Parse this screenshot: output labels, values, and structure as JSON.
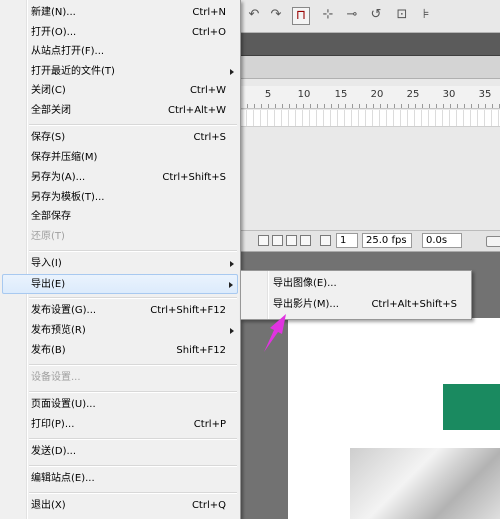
{
  "menu": {
    "items": [
      {
        "label": "新建(N)...",
        "shortcut": "Ctrl+N"
      },
      {
        "label": "打开(O)...",
        "shortcut": "Ctrl+O"
      },
      {
        "label": "从站点打开(F)...",
        "shortcut": ""
      },
      {
        "label": "打开最近的文件(T)",
        "shortcut": ""
      },
      {
        "label": "关闭(C)",
        "shortcut": "Ctrl+W"
      },
      {
        "label": "全部关闭",
        "shortcut": "Ctrl+Alt+W"
      },
      {
        "label": "保存(S)",
        "shortcut": "Ctrl+S"
      },
      {
        "label": "保存并压缩(M)",
        "shortcut": ""
      },
      {
        "label": "另存为(A)...",
        "shortcut": "Ctrl+Shift+S"
      },
      {
        "label": "另存为模板(T)...",
        "shortcut": ""
      },
      {
        "label": "全部保存",
        "shortcut": ""
      },
      {
        "label": "还原(T)",
        "shortcut": ""
      },
      {
        "label": "导入(I)",
        "shortcut": ""
      },
      {
        "label": "导出(E)",
        "shortcut": ""
      },
      {
        "label": "发布设置(G)...",
        "shortcut": "Ctrl+Shift+F12"
      },
      {
        "label": "发布预览(R)",
        "shortcut": ""
      },
      {
        "label": "发布(B)",
        "shortcut": "Shift+F12"
      },
      {
        "label": "设备设置...",
        "shortcut": ""
      },
      {
        "label": "页面设置(U)...",
        "shortcut": ""
      },
      {
        "label": "打印(P)...",
        "shortcut": "Ctrl+P"
      },
      {
        "label": "发送(D)...",
        "shortcut": ""
      },
      {
        "label": "编辑站点(E)...",
        "shortcut": ""
      },
      {
        "label": "退出(X)",
        "shortcut": "Ctrl+Q"
      }
    ]
  },
  "submenu": {
    "items": [
      {
        "label": "导出图像(E)...",
        "shortcut": ""
      },
      {
        "label": "导出影片(M)...",
        "shortcut": "Ctrl+Alt+Shift+S"
      }
    ]
  },
  "timeline": {
    "ruler": [
      "5",
      "10",
      "15",
      "20",
      "25",
      "30",
      "35"
    ],
    "frame": "1",
    "fps": "25.0 fps",
    "time": "0.0s"
  },
  "colors": {
    "highlight_border": "#a8c9f0",
    "stage_object": "#1a8a60",
    "pointer_arrow": "#e033e0"
  }
}
